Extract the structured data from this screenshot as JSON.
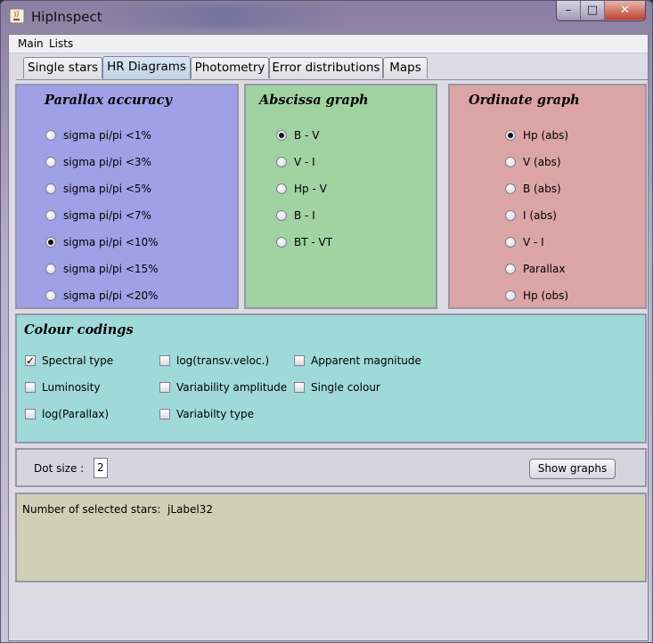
{
  "window": {
    "title": "HipInspect",
    "minimize": "–",
    "maximize": "□",
    "close": "✕"
  },
  "menu": [
    {
      "label": "Main"
    },
    {
      "label": "Lists"
    }
  ],
  "tabs": [
    {
      "label": "Single stars"
    },
    {
      "label": "HR Diagrams"
    },
    {
      "label": "Photometry"
    },
    {
      "label": "Error distributions"
    },
    {
      "label": "Maps"
    }
  ],
  "parallax": {
    "title": "Parallax accuracy",
    "color": "#9fa0e6",
    "options": [
      {
        "label": "sigma pi/pi <1%",
        "selected": false
      },
      {
        "label": "sigma pi/pi <3%",
        "selected": false
      },
      {
        "label": "sigma pi/pi <5%",
        "selected": false
      },
      {
        "label": "sigma pi/pi <7%",
        "selected": false
      },
      {
        "label": "sigma pi/pi <10%",
        "selected": true
      },
      {
        "label": "sigma pi/pi <15%",
        "selected": false
      },
      {
        "label": "sigma pi/pi <20%",
        "selected": false
      }
    ]
  },
  "abscissa": {
    "title": "Abscissa graph",
    "color": "#a1d2a2",
    "options": [
      {
        "label": "B - V",
        "selected": true
      },
      {
        "label": "V - I",
        "selected": false
      },
      {
        "label": "Hp - V",
        "selected": false
      },
      {
        "label": "B - I",
        "selected": false
      },
      {
        "label": "BT - VT",
        "selected": false
      }
    ]
  },
  "ordinate": {
    "title": "Ordinate graph",
    "color": "#dba5a5",
    "options": [
      {
        "label": "Hp (abs)",
        "selected": true
      },
      {
        "label": "V (abs)",
        "selected": false
      },
      {
        "label": "B (abs)",
        "selected": false
      },
      {
        "label": "I (abs)",
        "selected": false
      },
      {
        "label": "V - I",
        "selected": false
      },
      {
        "label": "Parallax",
        "selected": false
      },
      {
        "label": "Hp (obs)",
        "selected": false
      }
    ]
  },
  "colour": {
    "title": "Colour codings",
    "color": "#a0d9da",
    "check_mark": "✓",
    "columns": [
      [
        {
          "label": "Spectral type",
          "checked": true
        },
        {
          "label": "Luminosity",
          "checked": false
        },
        {
          "label": "log(Parallax)",
          "checked": false
        }
      ],
      [
        {
          "label": "log(transv.veloc.)",
          "checked": false
        },
        {
          "label": "Variability amplitude",
          "checked": false
        },
        {
          "label": "Variabilty type",
          "checked": false
        }
      ],
      [
        {
          "label": "Apparent magnitude",
          "checked": false
        },
        {
          "label": "Single colour",
          "checked": false
        }
      ]
    ]
  },
  "controls": {
    "dot_label": "Dot size :",
    "dot_value": "2",
    "show_graphs": "Show graphs"
  },
  "selection": {
    "label": "Number of selected stars:",
    "value": "jLabel32",
    "color": "#cfd0b4"
  }
}
